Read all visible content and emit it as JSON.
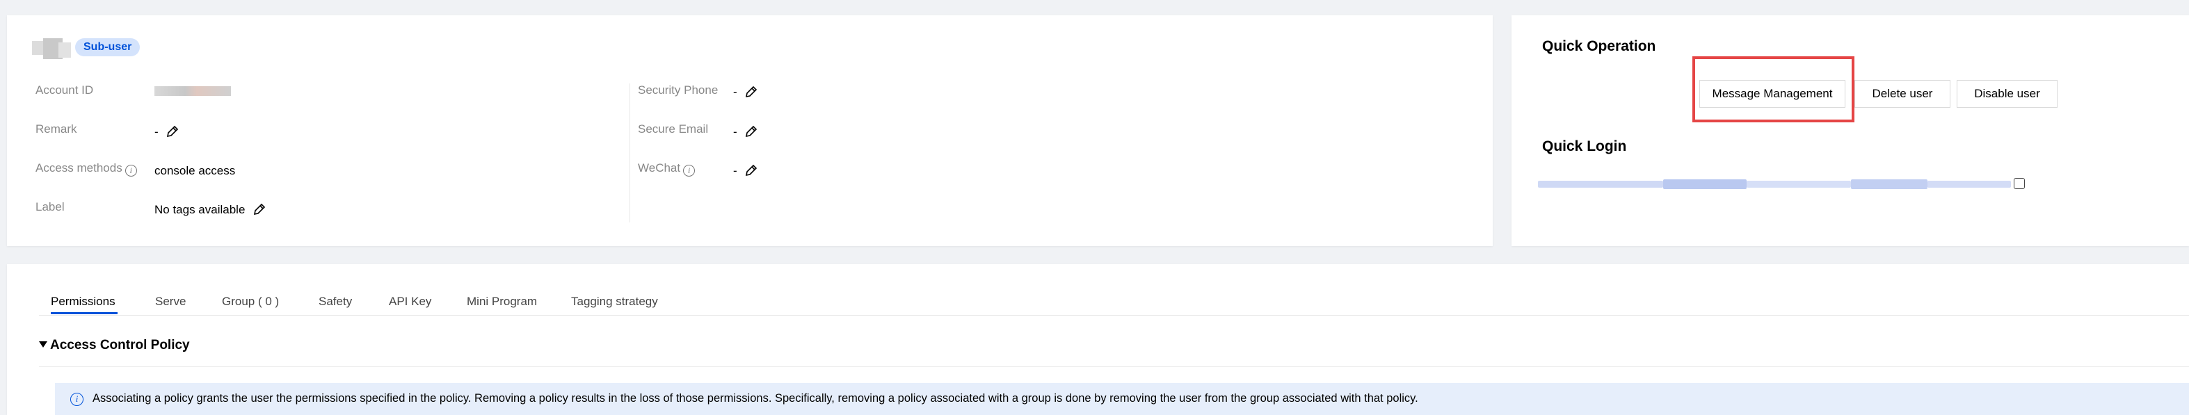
{
  "user": {
    "badge": "Sub-user"
  },
  "details_left": [
    {
      "label": "Account ID",
      "value": ""
    },
    {
      "label": "Remark",
      "value": "-"
    },
    {
      "label": "Access methods",
      "value": "console access"
    },
    {
      "label": "Label",
      "value": "No tags available"
    }
  ],
  "details_right": [
    {
      "label": "Security Phone",
      "value": "-"
    },
    {
      "label": "Secure Email",
      "value": "-"
    },
    {
      "label": "WeChat",
      "value": "-"
    }
  ],
  "quick_operation": {
    "title": "Quick Operation",
    "buttons": [
      "Message Management",
      "Delete user",
      "Disable user"
    ]
  },
  "quick_login": {
    "title": "Quick Login"
  },
  "tabs": [
    {
      "label": "Permissions",
      "active": true
    },
    {
      "label": "Serve",
      "active": false
    },
    {
      "label": "Group ( 0 )",
      "active": false
    },
    {
      "label": "Safety",
      "active": false
    },
    {
      "label": "API Key",
      "active": false
    },
    {
      "label": "Mini Program",
      "active": false
    },
    {
      "label": "Tagging strategy",
      "active": false
    }
  ],
  "policy": {
    "title": "Access Control Policy",
    "notice": "Associating a policy grants the user the permissions specified in the policy. Removing a policy results in the loss of those permissions. Specifically, removing a policy associated with a group is done by removing the user from the group associated with that policy."
  },
  "colors": {
    "accent": "#0052d9",
    "badge_bg": "#d4e3fc",
    "highlight_border": "#e54545",
    "notice_bg": "#e6eefb"
  },
  "icons": {
    "edit": "pencil-icon",
    "info": "info-icon",
    "collapse": "caret-down-icon",
    "copy": "copy-icon"
  }
}
